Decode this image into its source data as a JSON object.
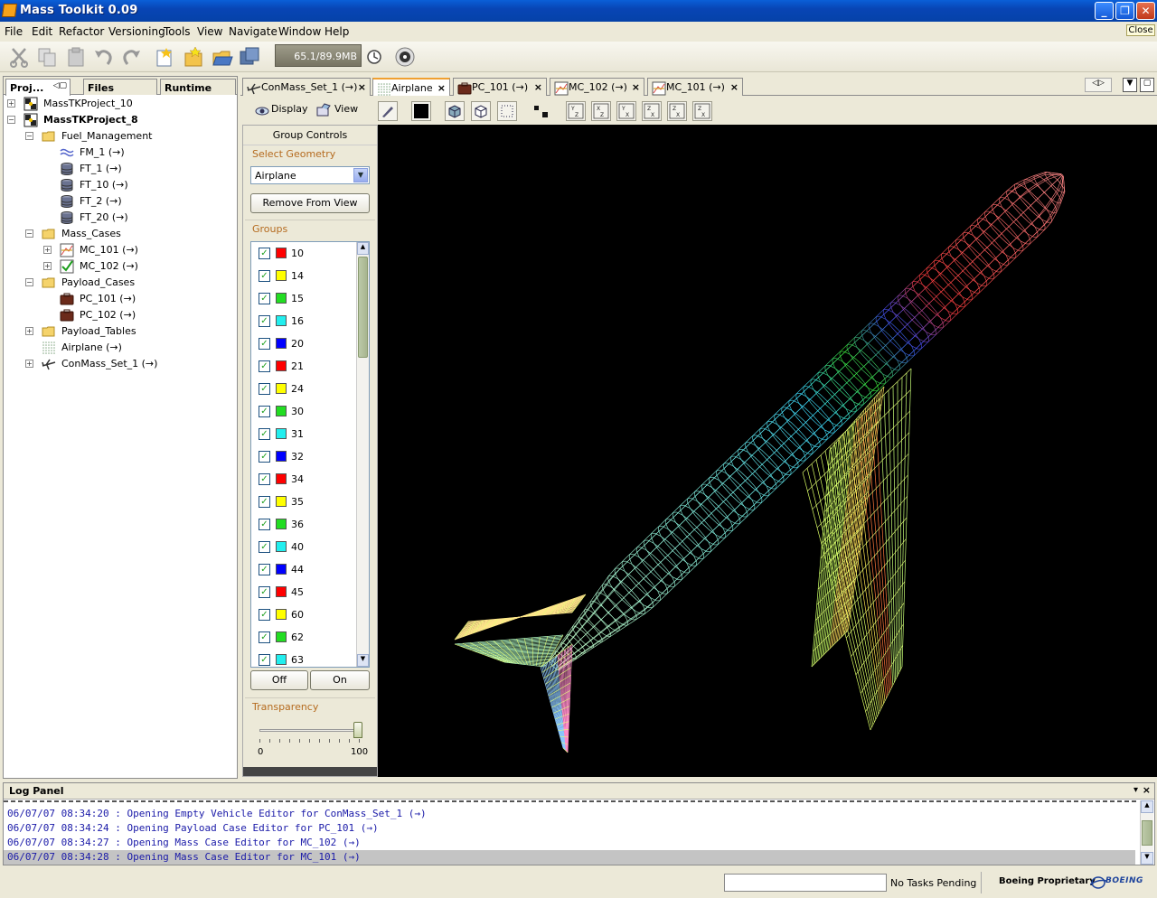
{
  "window": {
    "title": "Mass Toolkit 0.09",
    "close_label": "Close"
  },
  "menu": [
    "File",
    "Edit",
    "Refactor",
    "Versioning",
    "Tools",
    "View",
    "Navigate",
    "Window",
    "Help"
  ],
  "toolbar": {
    "memory": "65.1/89.9MB"
  },
  "left_tabs": [
    "Proj...",
    "Files",
    "Runtime"
  ],
  "tree": [
    {
      "label": "MassTKProject_10",
      "level": 0,
      "expander": "+",
      "icon": "project-icon",
      "bold": false
    },
    {
      "label": "MassTKProject_8",
      "level": 0,
      "expander": "-",
      "icon": "project-icon",
      "bold": true
    },
    {
      "label": "Fuel_Management",
      "level": 1,
      "expander": "-",
      "icon": "folder-icon",
      "bold": false
    },
    {
      "label": "FM_1 (→)",
      "level": 2,
      "expander": "",
      "icon": "fuel-management-icon",
      "bold": false
    },
    {
      "label": "FT_1 (→)",
      "level": 2,
      "expander": "",
      "icon": "fuel-tank-icon",
      "bold": false
    },
    {
      "label": "FT_10 (→)",
      "level": 2,
      "expander": "",
      "icon": "fuel-tank-icon",
      "bold": false
    },
    {
      "label": "FT_2 (→)",
      "level": 2,
      "expander": "",
      "icon": "fuel-tank-icon",
      "bold": false
    },
    {
      "label": "FT_20 (→)",
      "level": 2,
      "expander": "",
      "icon": "fuel-tank-icon",
      "bold": false
    },
    {
      "label": "Mass_Cases",
      "level": 1,
      "expander": "-",
      "icon": "folder-icon",
      "bold": false
    },
    {
      "label": "MC_101 (→)",
      "level": 2,
      "expander": "+",
      "icon": "mass-case-chart-icon",
      "bold": false
    },
    {
      "label": "MC_102 (→)",
      "level": 2,
      "expander": "+",
      "icon": "mass-case-check-icon",
      "bold": false
    },
    {
      "label": "Payload_Cases",
      "level": 1,
      "expander": "-",
      "icon": "folder-icon",
      "bold": false
    },
    {
      "label": "PC_101 (→)",
      "level": 2,
      "expander": "",
      "icon": "payload-case-icon",
      "bold": false
    },
    {
      "label": "PC_102 (→)",
      "level": 2,
      "expander": "",
      "icon": "payload-case-icon",
      "bold": false
    },
    {
      "label": "Payload_Tables",
      "level": 1,
      "expander": "+",
      "icon": "folder-icon",
      "bold": false
    },
    {
      "label": "Airplane (→)",
      "level": 1,
      "expander": "",
      "icon": "geometry-icon",
      "bold": false
    },
    {
      "label": "ConMass_Set_1 (→)",
      "level": 1,
      "expander": "+",
      "icon": "airplane-icon",
      "bold": false
    }
  ],
  "editor_tabs": [
    {
      "label": "ConMass_Set_1 (→)",
      "icon": "airplane-icon",
      "active": false
    },
    {
      "label": "Airplane",
      "icon": "geometry-icon",
      "active": true
    },
    {
      "label": "PC_101 (→)",
      "icon": "payload-case-icon",
      "active": false
    },
    {
      "label": "MC_102 (→)",
      "icon": "mass-case-chart-icon",
      "active": false
    },
    {
      "label": "MC_101 (→)",
      "icon": "mass-case-chart-icon",
      "active": false
    }
  ],
  "view_toolbar": {
    "display": "Display",
    "view": "View",
    "axis_buttons": [
      "YZ",
      "XZ",
      "YX",
      "ZX",
      "ZX",
      "ZX"
    ]
  },
  "group_controls": {
    "title": "Group Controls",
    "select_geometry_label": "Select Geometry",
    "geometry_value": "Airplane",
    "remove_button": "Remove From View",
    "groups_label": "Groups",
    "groups": [
      {
        "id": "10",
        "color": "#ff0000",
        "checked": true
      },
      {
        "id": "14",
        "color": "#ffff00",
        "checked": true
      },
      {
        "id": "15",
        "color": "#22dd22",
        "checked": true
      },
      {
        "id": "16",
        "color": "#22eeee",
        "checked": true
      },
      {
        "id": "20",
        "color": "#0000ff",
        "checked": true
      },
      {
        "id": "21",
        "color": "#ff0000",
        "checked": true
      },
      {
        "id": "24",
        "color": "#ffff00",
        "checked": true
      },
      {
        "id": "30",
        "color": "#22dd22",
        "checked": true
      },
      {
        "id": "31",
        "color": "#22eeee",
        "checked": true
      },
      {
        "id": "32",
        "color": "#0000ff",
        "checked": true
      },
      {
        "id": "34",
        "color": "#ff0000",
        "checked": true
      },
      {
        "id": "35",
        "color": "#ffff00",
        "checked": true
      },
      {
        "id": "36",
        "color": "#22dd22",
        "checked": true
      },
      {
        "id": "40",
        "color": "#22eeee",
        "checked": true
      },
      {
        "id": "44",
        "color": "#0000ff",
        "checked": true
      },
      {
        "id": "45",
        "color": "#ff0000",
        "checked": true
      },
      {
        "id": "60",
        "color": "#ffff00",
        "checked": true
      },
      {
        "id": "62",
        "color": "#22dd22",
        "checked": true
      },
      {
        "id": "63",
        "color": "#22eeee",
        "checked": true
      }
    ],
    "off_button": "Off",
    "on_button": "On",
    "transparency_label": "Transparency",
    "slider_min": "0",
    "slider_max": "100",
    "slider_value": 100
  },
  "log": {
    "title": "Log Panel",
    "lines": [
      "06/07/07 08:34:20 : Opening Empty Vehicle Editor for ConMass_Set_1 (→)",
      "06/07/07 08:34:24 : Opening Payload Case Editor for PC_101 (→)",
      "06/07/07 08:34:27 : Opening Mass Case Editor for MC_102 (→)",
      "06/07/07 08:34:28 : Opening Mass Case Editor for MC_101 (→)"
    ]
  },
  "status": {
    "tasks": "No Tasks Pending",
    "proprietary": "Boeing Proprietary",
    "logo": "BOEING"
  }
}
